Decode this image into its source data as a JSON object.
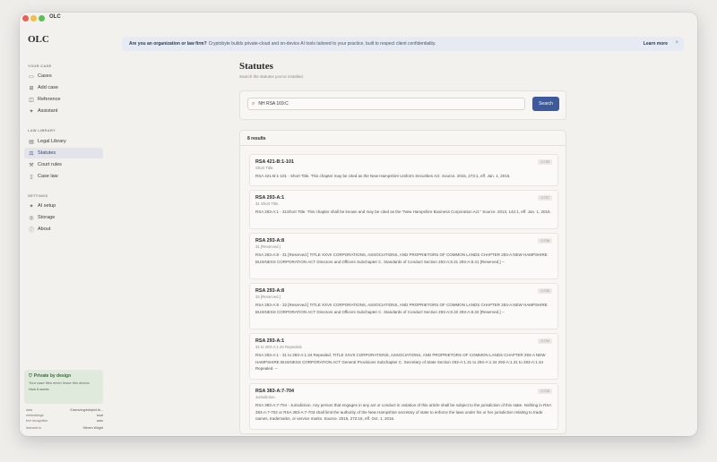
{
  "window": {
    "title": "OLC"
  },
  "sidebar": {
    "brand": "OLC",
    "sections": [
      {
        "label": "YOUR CASE",
        "items": [
          {
            "label": "Cases",
            "icon": "briefcase-icon"
          },
          {
            "label": "Add case",
            "icon": "plus-square-icon"
          },
          {
            "label": "Reference",
            "icon": "book-icon"
          },
          {
            "label": "Assistant",
            "icon": "sparkle-icon"
          }
        ]
      },
      {
        "label": "LAW LIBRARY",
        "items": [
          {
            "label": "Legal Library",
            "icon": "library-icon"
          },
          {
            "label": "Statutes",
            "icon": "scales-icon",
            "active": true
          },
          {
            "label": "Court rules",
            "icon": "gavel-icon"
          },
          {
            "label": "Case law",
            "icon": "document-icon"
          }
        ]
      },
      {
        "label": "SETTINGS",
        "items": [
          {
            "label": "AI setup",
            "icon": "sparkle-icon"
          },
          {
            "label": "Storage",
            "icon": "database-icon"
          },
          {
            "label": "About",
            "icon": "info-icon"
          }
        ]
      }
    ],
    "privacy": {
      "title": "Private by design",
      "description": "Your case files never leave this device.",
      "link": "How it works"
    },
    "meta": [
      {
        "key": "data",
        "value": "/Users/cryptobyte/Lib..."
      },
      {
        "key": "embeddings",
        "value": "local"
      },
      {
        "key": "text recognition",
        "value": "auto"
      },
      {
        "key": "licensed to",
        "value": "Steven Wright"
      }
    ]
  },
  "banner": {
    "bold": "Are you an organization or law firm?",
    "text": "Cryptobyte builds private-cloud and on-device AI tools tailored to your practice, built to respect client confidentiality.",
    "link": "Learn more",
    "close": "×"
  },
  "page": {
    "title": "Statutes",
    "subtitle": "Search the statutes you've installed."
  },
  "search": {
    "value": "NH RSA 169:C",
    "button": "Search"
  },
  "results": {
    "count_label": "8 results",
    "items": [
      {
        "title": "RSA 421-B:1-101",
        "subtitle": "Short Title.",
        "score": "0.733",
        "body": "RSA 421-B:1-101 - Short Title. This chapter may be cited as the New Hampshire Uniform Securities Act. Source. 2015, 273:1, eff. Jan. 1, 2016."
      },
      {
        "title": "RSA 293-A:1",
        "subtitle": "31 Short Title.",
        "score": "0.727",
        "body": "RSA 293-A:1 - 31Short Title. This chapter shall be known and may be cited as the \"New Hampshire Business Corporation Act.\" Source. 2013, 142:1, eff. Jan. 1, 2016."
      },
      {
        "title": "RSA 293-A:8",
        "subtitle": "31 [Reserved.]",
        "score": "0.726",
        "body": "RSA 293-A:8 - 31 [Reserved.] TITLE XXVII CORPORATIONS, ASSOCIATIONS, AND PROPRIETORS OF COMMON LANDS CHAPTER 293-A NEW HAMPSHIRE BUSINESS CORPORATION ACT Directors and Officers Subchapter C. Standards of Conduct Section 293-A:8.31 293-A:8.31 [Reserved.] --"
      },
      {
        "title": "RSA 293-A:8",
        "subtitle": "32 [Reserved.]",
        "score": "0.725",
        "body": "RSA 293-A:8 - 32 [Reserved.] TITLE XXVII CORPORATIONS, ASSOCIATIONS, AND PROPRIETORS OF COMMON LANDS CHAPTER 293-A NEW HAMPSHIRE BUSINESS CORPORATION ACT Directors and Officers Subchapter C. Standards of Conduct Section 293-A:8.32 293-A:8.32 [Reserved.] --"
      },
      {
        "title": "RSA 293-A:1",
        "subtitle": "31 to 293-A:1.34 Repealed.",
        "score": "0.724",
        "body": "RSA 293-A:1 - 31 to 293-A:1.34 Repealed. TITLE XXVII CORPORATIONS, ASSOCIATIONS, AND PROPRIETORS OF COMMON LANDS CHAPTER 293-A NEW HAMPSHIRE BUSINESS CORPORATION ACT General Provisions Subchapter C. Secretary of State Section 293-A:1.31 to 293-A:1.34 293-A:1.31 to 293-A:1.34 Repealed. --"
      },
      {
        "title": "RSA 383-A:7-704",
        "subtitle": "Jurisdiction.",
        "score": "0.723",
        "body": "RSA 383-A:7-704 - Jurisdiction. Any person that engages in any act or conduct in violation of this article shall be subject to the jurisdiction of this state. Nothing in RSA 383-A:7-702 or RSA 383-A:7-703 shall limit the authority of the New Hampshire secretary of state to enforce the laws under his or her jurisdiction relating to trade names, trademarks, or service marks. Source. 2015, 272:16, eff. Oct. 1, 2016."
      }
    ]
  }
}
